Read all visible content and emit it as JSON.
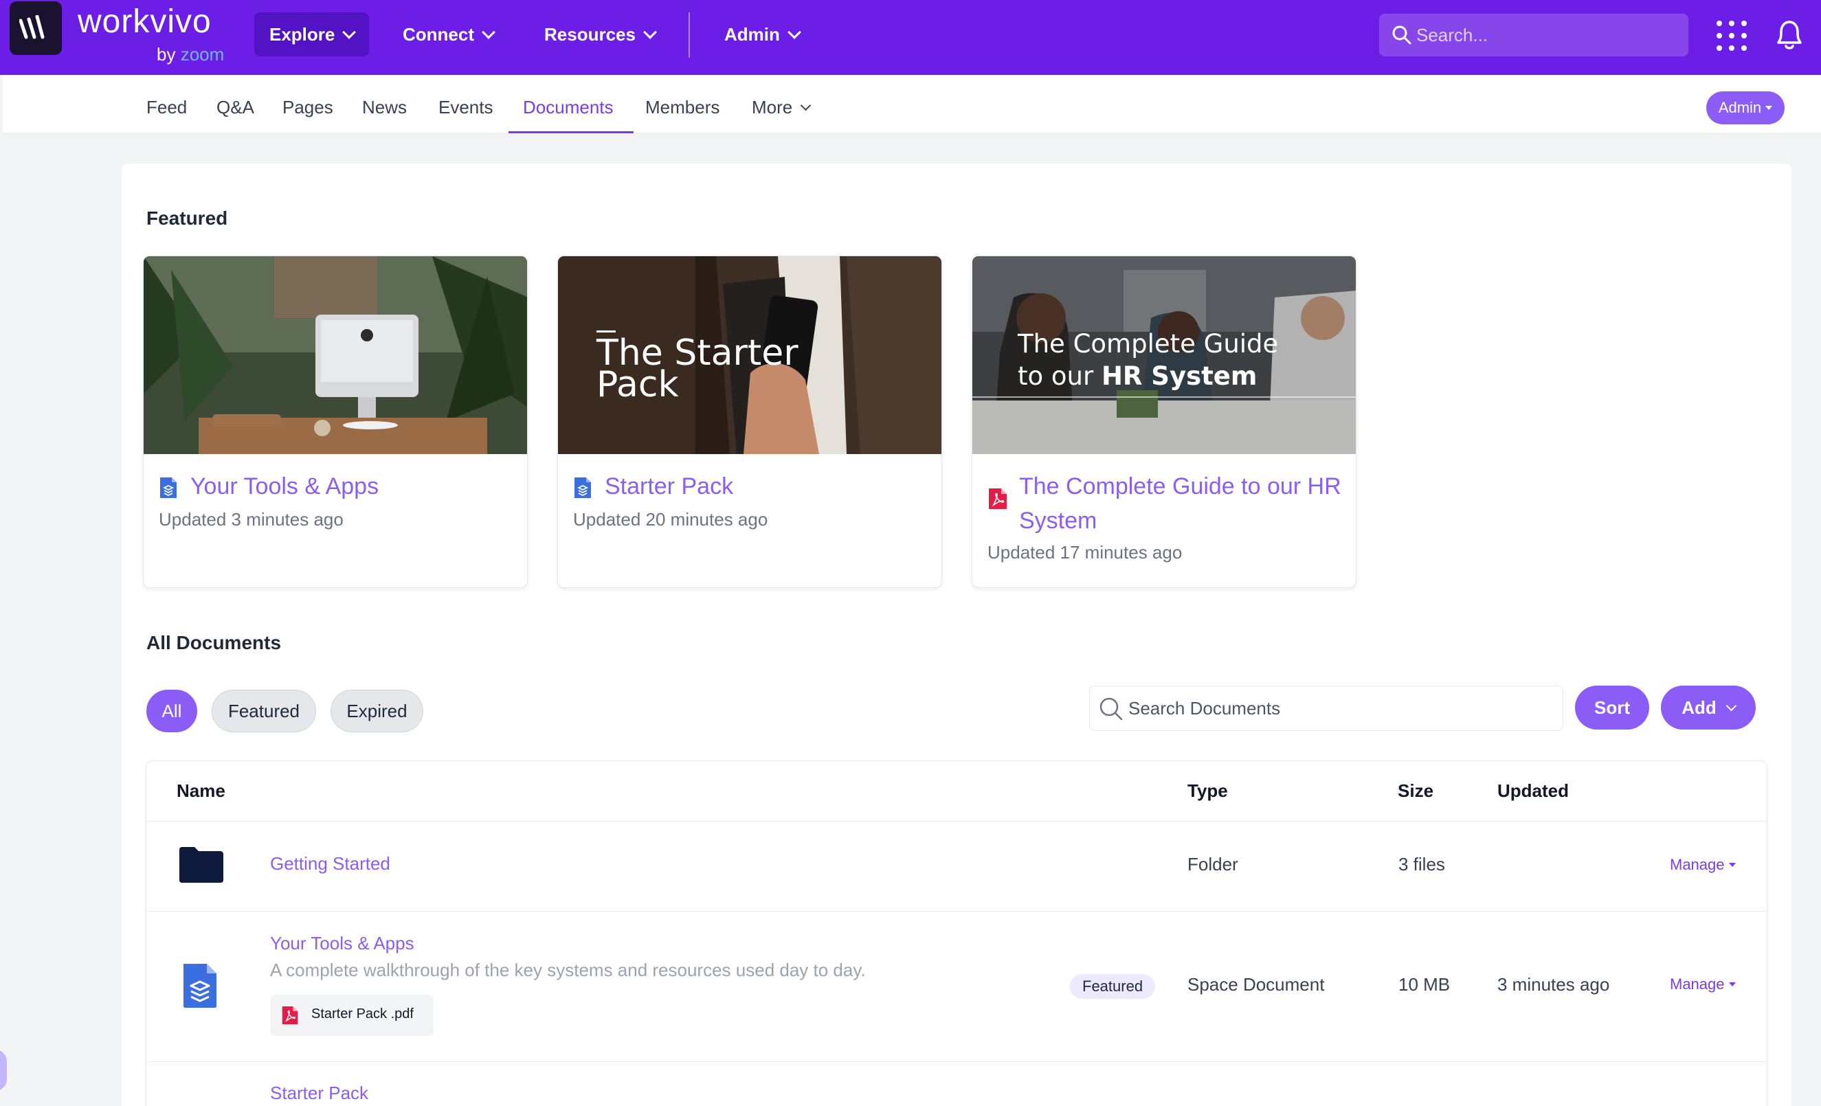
{
  "header": {
    "brand": "workvivo",
    "brand_by": "by",
    "brand_by_name": "zoom",
    "nav": [
      {
        "label": "Explore"
      },
      {
        "label": "Connect"
      },
      {
        "label": "Resources"
      },
      {
        "label": "Admin"
      }
    ],
    "search_placeholder": "Search...",
    "colors": {
      "bar": "#6c1ee6",
      "active_nav": "#5312c4"
    }
  },
  "subnav": {
    "items": [
      "Feed",
      "Q&A",
      "Pages",
      "News",
      "Events",
      "Documents",
      "Members",
      "More"
    ],
    "active": "Documents",
    "admin_label": "Admin"
  },
  "featured": {
    "title": "Featured",
    "cards": [
      {
        "title": "Your Tools & Apps",
        "updated": "Updated 3 minutes ago",
        "icon": "document-icon"
      },
      {
        "title": "Starter Pack",
        "updated": "Updated 20 minutes ago",
        "icon": "document-icon",
        "image_text": [
          "The Starter",
          "Pack"
        ]
      },
      {
        "title": "The Complete Guide to our HR System",
        "updated": "Updated 17 minutes ago",
        "icon": "pdf-icon",
        "image_text": [
          "The Complete Guide",
          "to our ",
          "HR System"
        ]
      }
    ]
  },
  "all_documents": {
    "title": "All Documents",
    "filters": [
      "All",
      "Featured",
      "Expired"
    ],
    "active_filter": "All",
    "search_placeholder": "Search Documents",
    "sort_label": "Sort",
    "add_label": "Add",
    "columns": [
      "Name",
      "Type",
      "Size",
      "Updated"
    ],
    "rows": [
      {
        "name": "Getting Started",
        "type": "Folder",
        "size": "3 files",
        "updated": "",
        "manage": "Manage",
        "icon": "folder-icon"
      },
      {
        "name": "Your Tools & Apps",
        "description": "A complete walkthrough of the key systems and resources used day to day.",
        "badge": "Featured",
        "attachment": "Starter Pack .pdf",
        "type": "Space Document",
        "size": "10 MB",
        "updated": "3 minutes ago",
        "manage": "Manage",
        "icon": "document-icon"
      },
      {
        "name": "Starter Pack"
      }
    ]
  },
  "colors": {
    "accent": "#8b5cf6",
    "accent_dark": "#7c3aed",
    "pdf": "#e11d48",
    "doc": "#3b6fe0"
  }
}
